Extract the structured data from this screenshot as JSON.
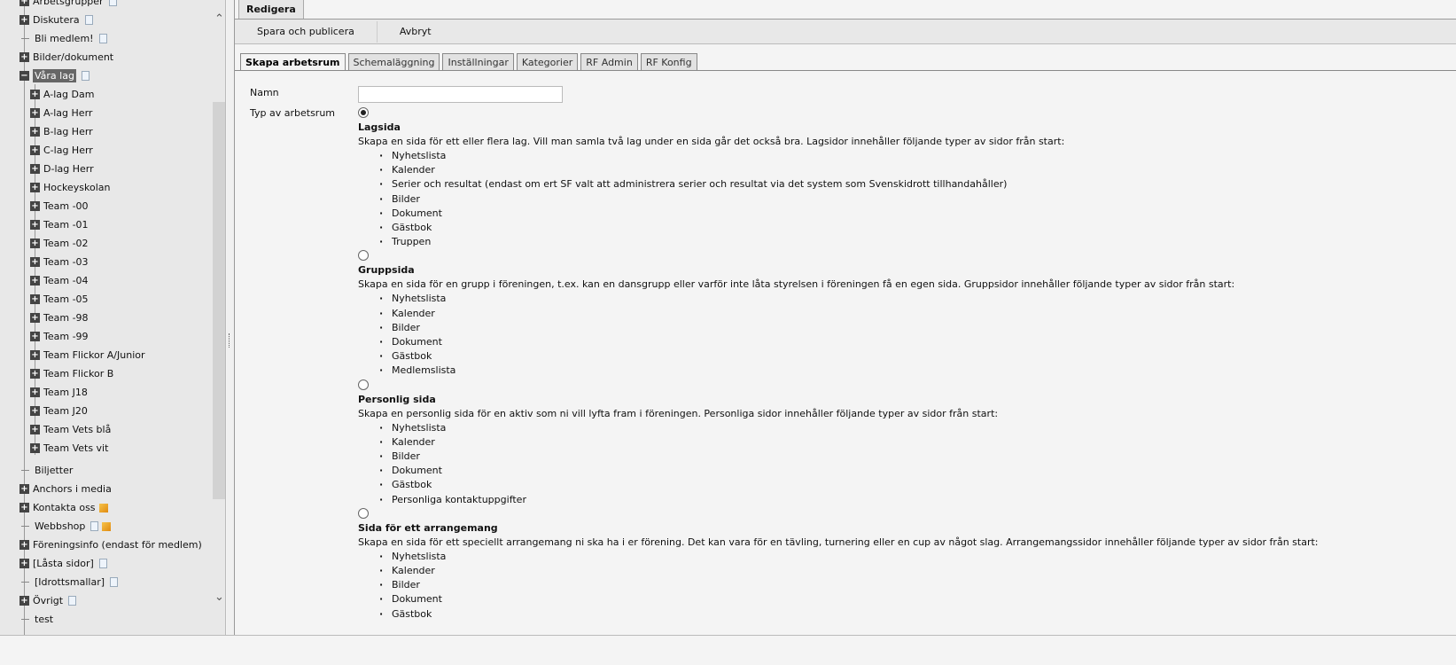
{
  "sidebar": {
    "items": [
      {
        "label": "Arbetsgrupper",
        "level": 1,
        "expander": "plus",
        "icons": [
          "page"
        ]
      },
      {
        "label": "Diskutera",
        "level": 1,
        "expander": "plus",
        "icons": [
          "page"
        ]
      },
      {
        "label": "Bli medlem!",
        "level": 1,
        "expander": "none",
        "icons": [
          "page"
        ]
      },
      {
        "label": "Bilder/dokument",
        "level": 1,
        "expander": "plus",
        "icons": []
      },
      {
        "label": "Våra lag",
        "level": 1,
        "expander": "minus",
        "icons": [
          "page"
        ],
        "selected": true
      },
      {
        "label": "A-lag Dam",
        "level": 2,
        "expander": "plus",
        "icons": []
      },
      {
        "label": "A-lag Herr",
        "level": 2,
        "expander": "plus",
        "icons": []
      },
      {
        "label": "B-lag Herr",
        "level": 2,
        "expander": "plus",
        "icons": []
      },
      {
        "label": "C-lag Herr",
        "level": 2,
        "expander": "plus",
        "icons": []
      },
      {
        "label": "D-lag Herr",
        "level": 2,
        "expander": "plus",
        "icons": []
      },
      {
        "label": "Hockeyskolan",
        "level": 2,
        "expander": "plus",
        "icons": []
      },
      {
        "label": "Team -00",
        "level": 2,
        "expander": "plus",
        "icons": []
      },
      {
        "label": "Team -01",
        "level": 2,
        "expander": "plus",
        "icons": []
      },
      {
        "label": "Team -02",
        "level": 2,
        "expander": "plus",
        "icons": []
      },
      {
        "label": "Team -03",
        "level": 2,
        "expander": "plus",
        "icons": []
      },
      {
        "label": "Team -04",
        "level": 2,
        "expander": "plus",
        "icons": []
      },
      {
        "label": "Team -05",
        "level": 2,
        "expander": "plus",
        "icons": []
      },
      {
        "label": "Team -98",
        "level": 2,
        "expander": "plus",
        "icons": []
      },
      {
        "label": "Team -99",
        "level": 2,
        "expander": "plus",
        "icons": []
      },
      {
        "label": "Team Flickor A/Junior",
        "level": 2,
        "expander": "plus",
        "icons": []
      },
      {
        "label": "Team Flickor B",
        "level": 2,
        "expander": "plus",
        "icons": []
      },
      {
        "label": "Team J18",
        "level": 2,
        "expander": "plus",
        "icons": []
      },
      {
        "label": "Team J20",
        "level": 2,
        "expander": "plus",
        "icons": []
      },
      {
        "label": "Team Vets blå",
        "level": 2,
        "expander": "plus",
        "icons": []
      },
      {
        "label": "Team Vets vit",
        "level": 2,
        "expander": "plus",
        "icons": []
      },
      {
        "label": "Biljetter",
        "level": 1,
        "expander": "none",
        "icons": []
      },
      {
        "label": "Anchors i media",
        "level": 1,
        "expander": "plus",
        "icons": []
      },
      {
        "label": "Kontakta oss",
        "level": 1,
        "expander": "plus",
        "icons": [
          "link"
        ]
      },
      {
        "label": "Webbshop",
        "level": 1,
        "expander": "none",
        "icons": [
          "page",
          "link"
        ]
      },
      {
        "label": "Föreningsinfo (endast för medlem)",
        "level": 1,
        "expander": "plus",
        "icons": []
      },
      {
        "label": "[Låsta sidor]",
        "level": 1,
        "expander": "plus",
        "icons": [
          "page"
        ]
      },
      {
        "label": "[Idrottsmallar]",
        "level": 1,
        "expander": "none",
        "icons": [
          "page"
        ]
      },
      {
        "label": "Övrigt",
        "level": 1,
        "expander": "plus",
        "icons": [
          "page"
        ]
      },
      {
        "label": "test",
        "level": 1,
        "expander": "none",
        "icons": []
      }
    ]
  },
  "header": {
    "tab": "Redigera"
  },
  "toolbar": {
    "save_label": "Spara och publicera",
    "cancel_label": "Avbryt"
  },
  "tabs": [
    {
      "label": "Skapa arbetsrum",
      "active": true
    },
    {
      "label": "Schemaläggning"
    },
    {
      "label": "Inställningar"
    },
    {
      "label": "Kategorier"
    },
    {
      "label": "RF Admin"
    },
    {
      "label": "RF Konfig"
    }
  ],
  "form": {
    "name_label": "Namn",
    "name_value": "",
    "type_label": "Typ av arbetsrum",
    "types": [
      {
        "title": "Lagsida",
        "selected": true,
        "description": "Skapa en sida för ett eller flera lag. Vill man samla två lag under en sida går det också bra. Lagsidor innehåller följande typer av sidor från start:",
        "items": [
          "Nyhetslista",
          "Kalender",
          "Serier och resultat (endast om ert SF valt att administrera serier och resultat via det system som Svenskidrott tillhandahåller)",
          "Bilder",
          "Dokument",
          "Gästbok",
          "Truppen"
        ]
      },
      {
        "title": "Gruppsida",
        "selected": false,
        "description": "Skapa en sida för en grupp i föreningen, t.ex. kan en dansgrupp eller varför inte låta styrelsen i föreningen få en egen sida. Gruppsidor innehåller följande typer av sidor från start:",
        "items": [
          "Nyhetslista",
          "Kalender",
          "Bilder",
          "Dokument",
          "Gästbok",
          "Medlemslista"
        ]
      },
      {
        "title": "Personlig sida",
        "selected": false,
        "description": "Skapa en personlig sida för en aktiv som ni vill lyfta fram i föreningen. Personliga sidor innehåller följande typer av sidor från start:",
        "items": [
          "Nyhetslista",
          "Kalender",
          "Bilder",
          "Dokument",
          "Gästbok",
          "Personliga kontaktuppgifter"
        ]
      },
      {
        "title": "Sida för ett arrangemang",
        "selected": false,
        "description": "Skapa en sida för ett speciellt arrangemang ni ska ha i er förening. Det kan vara för en tävling, turnering eller en cup av något slag. Arrangemangssidor innehåller följande typer av sidor från start:",
        "items": [
          "Nyhetslista",
          "Kalender",
          "Bilder",
          "Dokument",
          "Gästbok"
        ]
      }
    ]
  }
}
